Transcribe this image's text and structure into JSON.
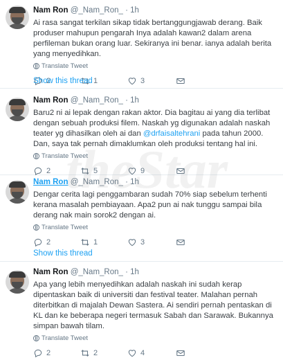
{
  "tweets": [
    {
      "name": "Nam Ron",
      "handle": "@_Nam_Ron_",
      "time": "· 1h",
      "text": "Ai rasa sangat terkilan sikap tidak bertanggungjawab derang. Baik produser mahupun pengarah Inya adalah kawan2 dalam arena perfileman bukan orang luar. Sekiranya ini benar. ianya adalah berita yang menyedihkan.",
      "translate": "Translate Tweet",
      "reply_count": "2",
      "retweet_count": "1",
      "like_count": "3",
      "show_thread": "Show this thread"
    },
    {
      "name": "Nam Ron",
      "handle": "@_Nam_Ron_",
      "time": "· 1h",
      "text_before": "Baru2 ni ai lepak dengan rakan aktor. Dia bagitau ai yang dia terlibat dengan sebuah produksi filem. Naskah yg digunakan adalah naskah teater yg dihasilkan oleh ai dan ",
      "mention": "@drfaisaltehrani",
      "text_after": " pada tahun 2000. Dan, saya tak pernah dimaklumkan oleh produksi tentang hal ini.",
      "translate": "Translate Tweet",
      "reply_count": "2",
      "retweet_count": "5",
      "like_count": "9"
    },
    {
      "name": "Nam Ron",
      "handle": "@_Nam_Ron_",
      "time": "· 1h",
      "text": "Dengar cerita lagi penggambaran sudah 70% siap sebelum terhenti kerana masalah pembiayaan. Apa2 pun ai nak tunggu sampai bila derang nak main sorok2 dengan ai.",
      "translate": "Translate Tweet",
      "reply_count": "2",
      "retweet_count": "1",
      "like_count": "3",
      "show_thread": "Show this thread"
    },
    {
      "name": "Nam Ron",
      "handle": "@_Nam_Ron_",
      "time": "· 1h",
      "text": "Apa yang lebih menyedihkan adalah naskah ini sudah kerap dipentaskan baik di universiti dan festival teater. Malahan pernah diterbitkan di majalah Dewan Sastera. Ai sendiri pernah pentaskan di KL dan ke beberapa negeri termasuk Sabah dan Sarawak. Bukannya simpan bawah tilam.",
      "translate": "Translate Tweet",
      "reply_count": "2",
      "retweet_count": "2",
      "like_count": "4"
    }
  ],
  "watermark": "theStar",
  "icons": {
    "reply": "reply-icon",
    "retweet": "retweet-icon",
    "like": "heart-icon",
    "translate": "globe-icon"
  },
  "colors": {
    "link": "#1da1f2",
    "muted": "#657786",
    "divider": "#e6ecf0"
  }
}
